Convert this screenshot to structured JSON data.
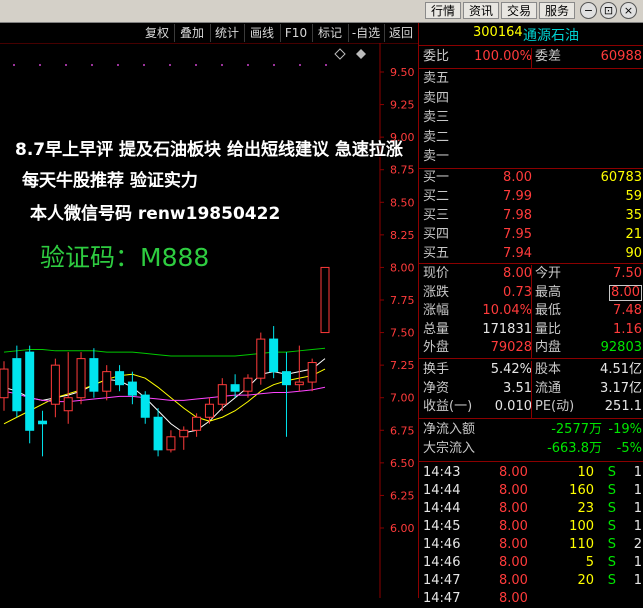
{
  "top_menu": {
    "buttons": [
      "行情",
      "资讯",
      "交易",
      "服务"
    ],
    "window_controls": [
      "−",
      "⊡",
      "×"
    ]
  },
  "toolbar": {
    "buttons": [
      "复权",
      "叠加",
      "统计",
      "画线",
      "F10",
      "标记",
      "-自选",
      "返回"
    ]
  },
  "price_axis": {
    "labels": [
      "9.50",
      "9.25",
      "9.00",
      "8.75",
      "8.50",
      "8.25",
      "8.00",
      "7.75",
      "7.50",
      "7.25",
      "7.00",
      "6.75",
      "6.50",
      "6.25",
      "6.00"
    ]
  },
  "overlay_text": {
    "line1": "8.7早上早评 提及石油板块 给出短线建议 急速拉涨",
    "line2": "每天牛股推荐 验证实力",
    "line3": "本人微信号码 renw19850422",
    "line4": "验证码：M888"
  },
  "chart_data": {
    "type": "candlestick",
    "ylim": [
      5.9,
      9.6
    ],
    "y_ticks": [
      9.5,
      9.25,
      9.0,
      8.75,
      8.5,
      8.25,
      8.0,
      7.75,
      7.5,
      7.25,
      7.0,
      6.75,
      6.5,
      6.25,
      6.0
    ],
    "candles": [
      {
        "o": 7.0,
        "h": 7.28,
        "l": 6.9,
        "c": 7.22
      },
      {
        "o": 7.3,
        "h": 7.4,
        "l": 6.85,
        "c": 6.9
      },
      {
        "o": 7.35,
        "h": 7.4,
        "l": 6.65,
        "c": 6.75
      },
      {
        "o": 6.82,
        "h": 6.9,
        "l": 6.55,
        "c": 6.8
      },
      {
        "o": 6.95,
        "h": 7.3,
        "l": 6.85,
        "c": 7.25
      },
      {
        "o": 6.9,
        "h": 7.35,
        "l": 6.8,
        "c": 7.0
      },
      {
        "o": 7.0,
        "h": 7.35,
        "l": 6.95,
        "c": 7.3
      },
      {
        "o": 7.3,
        "h": 7.38,
        "l": 7.0,
        "c": 7.05
      },
      {
        "o": 7.05,
        "h": 7.25,
        "l": 6.98,
        "c": 7.2
      },
      {
        "o": 7.2,
        "h": 7.25,
        "l": 7.05,
        "c": 7.1
      },
      {
        "o": 7.12,
        "h": 7.2,
        "l": 6.95,
        "c": 7.02
      },
      {
        "o": 7.02,
        "h": 7.05,
        "l": 6.8,
        "c": 6.85
      },
      {
        "o": 6.85,
        "h": 6.92,
        "l": 6.55,
        "c": 6.6
      },
      {
        "o": 6.6,
        "h": 6.75,
        "l": 6.58,
        "c": 6.7
      },
      {
        "o": 6.7,
        "h": 6.78,
        "l": 6.6,
        "c": 6.75
      },
      {
        "o": 6.75,
        "h": 6.88,
        "l": 6.7,
        "c": 6.85
      },
      {
        "o": 6.85,
        "h": 7.0,
        "l": 6.8,
        "c": 6.95
      },
      {
        "o": 6.95,
        "h": 7.15,
        "l": 6.9,
        "c": 7.1
      },
      {
        "o": 7.1,
        "h": 7.18,
        "l": 7.0,
        "c": 7.05
      },
      {
        "o": 7.05,
        "h": 7.18,
        "l": 7.0,
        "c": 7.15
      },
      {
        "o": 7.15,
        "h": 7.5,
        "l": 7.1,
        "c": 7.45
      },
      {
        "o": 7.45,
        "h": 7.55,
        "l": 7.15,
        "c": 7.2
      },
      {
        "o": 7.2,
        "h": 7.35,
        "l": 6.7,
        "c": 7.1
      },
      {
        "o": 7.1,
        "h": 7.4,
        "l": 7.05,
        "c": 7.12
      },
      {
        "o": 7.12,
        "h": 7.3,
        "l": 7.05,
        "c": 7.27
      },
      {
        "o": 7.5,
        "h": 8.0,
        "l": 7.5,
        "c": 8.0
      }
    ],
    "ma_lines": [
      {
        "color": "#ffffff",
        "values": [
          7.08,
          7.05,
          7.0,
          6.98,
          7.0,
          7.02,
          7.05,
          7.1,
          7.14,
          7.13,
          7.08,
          7.0,
          6.9,
          6.8,
          6.73,
          6.75,
          6.82,
          6.92,
          7.0,
          7.08,
          7.18,
          7.2,
          7.18,
          7.2,
          7.22,
          7.3
        ]
      },
      {
        "color": "#ffff00",
        "values": [
          6.8,
          6.85,
          6.9,
          6.95,
          7.0,
          7.03,
          7.06,
          7.1,
          7.14,
          7.17,
          7.18,
          7.15,
          7.08,
          7.0,
          6.92,
          6.85,
          6.82,
          6.85,
          6.9,
          6.97,
          7.05,
          7.1,
          7.13,
          7.15,
          7.17,
          7.22
        ]
      },
      {
        "color": "#ff44ff",
        "values": [
          7.05,
          7.03,
          7.0,
          6.98,
          6.97,
          6.97,
          6.98,
          6.99,
          7.0,
          7.01,
          7.01,
          7.0,
          6.99,
          6.98,
          6.98,
          6.99,
          7.0,
          7.01,
          7.02,
          7.02,
          7.03,
          7.04,
          7.04,
          7.05,
          7.06,
          7.08
        ]
      },
      {
        "color": "#00c800",
        "values": [
          7.35,
          7.36,
          7.37,
          7.37,
          7.36,
          7.36,
          7.36,
          7.36,
          7.35,
          7.35,
          7.35,
          7.34,
          7.33,
          7.32,
          7.32,
          7.32,
          7.32,
          7.32,
          7.32,
          7.33,
          7.34,
          7.35,
          7.35,
          7.36,
          7.37,
          7.38
        ]
      }
    ]
  },
  "quote": {
    "code": "300164",
    "name": "通源石油",
    "weibi_label": "委比",
    "weibi_value": "100.00%",
    "weicha_label": "委差",
    "weicha_value": "60988",
    "sell": [
      {
        "label": "卖五",
        "price": "",
        "vol": ""
      },
      {
        "label": "卖四",
        "price": "",
        "vol": ""
      },
      {
        "label": "卖三",
        "price": "",
        "vol": ""
      },
      {
        "label": "卖二",
        "price": "",
        "vol": ""
      },
      {
        "label": "卖一",
        "price": "",
        "vol": ""
      }
    ],
    "buy": [
      {
        "label": "买一",
        "price": "8.00",
        "vol": "60783"
      },
      {
        "label": "买二",
        "price": "7.99",
        "vol": "59"
      },
      {
        "label": "买三",
        "price": "7.98",
        "vol": "35"
      },
      {
        "label": "买四",
        "price": "7.95",
        "vol": "21"
      },
      {
        "label": "买五",
        "price": "7.94",
        "vol": "90"
      }
    ],
    "stats": [
      {
        "l1": "现价",
        "v1": "8.00",
        "c1": "red",
        "l2": "今开",
        "v2": "7.50",
        "c2": "red",
        "box": false
      },
      {
        "l1": "涨跌",
        "v1": "0.73",
        "c1": "red",
        "l2": "最高",
        "v2": "8.00",
        "c2": "red",
        "box": true
      },
      {
        "l1": "涨幅",
        "v1": "10.04%",
        "c1": "red",
        "l2": "最低",
        "v2": "7.48",
        "c2": "red",
        "box": false
      },
      {
        "l1": "总量",
        "v1": "171831",
        "c1": "white",
        "l2": "量比",
        "v2": "1.16",
        "c2": "red",
        "box": false
      },
      {
        "l1": "外盘",
        "v1": "79028",
        "c1": "red",
        "l2": "内盘",
        "v2": "92803",
        "c2": "green",
        "box": false
      }
    ],
    "fin": [
      {
        "l1": "换手",
        "v1": "5.42%",
        "l2": "股本",
        "v2": "4.51亿"
      },
      {
        "l1": "净资",
        "v1": "3.51",
        "l2": "流通",
        "v2": "3.17亿"
      },
      {
        "l1": "收益(一)",
        "v1": "0.010",
        "l2": "PE(动)",
        "v2": "251.1"
      }
    ],
    "flow": [
      {
        "label": "净流入额",
        "amount": "-2577万",
        "pct": "-19%"
      },
      {
        "label": "大宗流入",
        "amount": "-663.8万",
        "pct": "-5%"
      }
    ],
    "ticks": [
      {
        "time": "14:43",
        "price": "8.00",
        "vol": "10",
        "side": "S",
        "num": "1"
      },
      {
        "time": "14:44",
        "price": "8.00",
        "vol": "160",
        "side": "S",
        "num": "1"
      },
      {
        "time": "14:44",
        "price": "8.00",
        "vol": "23",
        "side": "S",
        "num": "1"
      },
      {
        "time": "14:45",
        "price": "8.00",
        "vol": "100",
        "side": "S",
        "num": "1"
      },
      {
        "time": "14:46",
        "price": "8.00",
        "vol": "110",
        "side": "S",
        "num": "2"
      },
      {
        "time": "14:46",
        "price": "8.00",
        "vol": "5",
        "side": "S",
        "num": "1"
      },
      {
        "time": "14:47",
        "price": "8.00",
        "vol": "20",
        "side": "S",
        "num": "1"
      },
      {
        "time": "14:47",
        "price": "8.00",
        "vol": "",
        "side": "",
        "num": ""
      }
    ]
  }
}
